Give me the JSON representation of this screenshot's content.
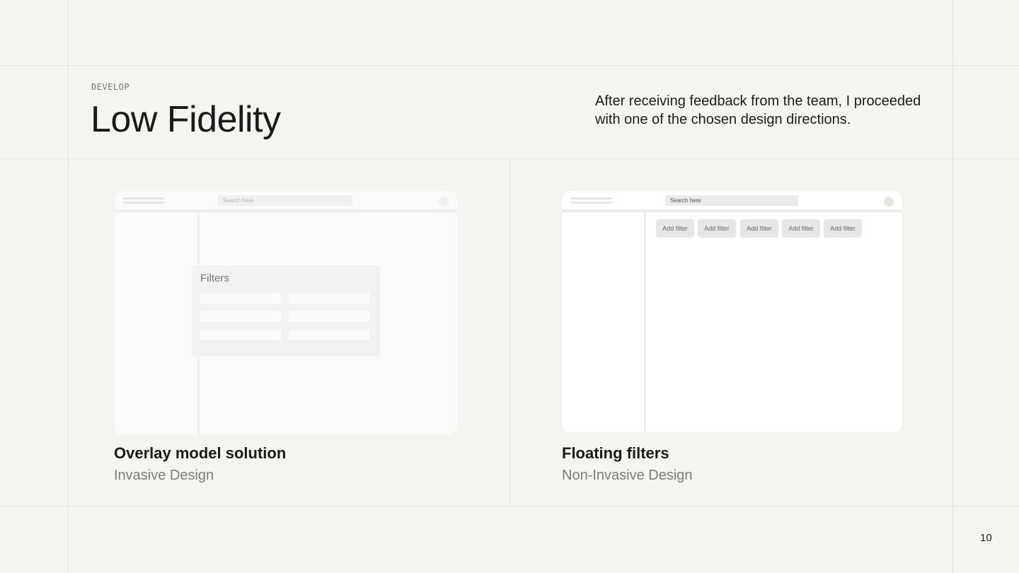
{
  "header": {
    "eyebrow": "DEVELOP",
    "title": "Low Fidelity",
    "intro": "After receiving feedback from the team, I proceeded with one of the chosen design directions."
  },
  "mockups": {
    "left": {
      "search_placeholder": "Search here",
      "overlay_title": "Filters",
      "caption_title": "Overlay model solution",
      "caption_subtitle": "Invasive Design"
    },
    "right": {
      "search_placeholder": "Search here",
      "filter_chips": [
        "Add filter",
        "Add filter",
        "Add filter",
        "Add filter",
        "Add filter"
      ],
      "caption_title": "Floating filters",
      "caption_subtitle": "Non-Invasive Design"
    }
  },
  "footer": {
    "page_number": "10"
  }
}
